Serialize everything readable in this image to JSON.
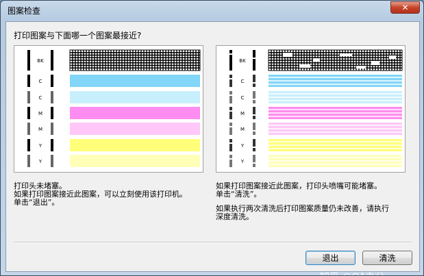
{
  "window": {
    "title": "图案检查",
    "close_glyph": "✕"
  },
  "dialog": {
    "question": "打印图案与下面哪一个图案最接近?",
    "left_panel": {
      "rows": [
        "BK",
        "C",
        "C",
        "M",
        "M",
        "Y",
        "Y"
      ],
      "caption_lines": [
        "打印头未堵塞。",
        "如果打印图案接近此图案，可以立刻使用该打印机。",
        "单击“退出”。"
      ]
    },
    "right_panel": {
      "rows": [
        "BK",
        "C",
        "C",
        "M",
        "M",
        "Y",
        "Y"
      ],
      "caption_lines": [
        "如果打印图案接近此图案，打印头喷嘴可能堵塞。",
        "单击“清洗”。"
      ],
      "caption2_lines": [
        "如果执行两次清洗后打印图案质量仍未改善，请执行",
        "深度清洗。"
      ]
    },
    "buttons": {
      "exit": "退出",
      "clean": "清洗"
    },
    "watermark": "知乎 @OA办公"
  },
  "colors": {
    "cyan": "#82d6f7",
    "light_cyan": "#c8effc",
    "magenta": "#ff8cf0",
    "light_magenta": "#ffc8f8",
    "yellow": "#ffff7a",
    "light_yellow": "#ffffb8"
  }
}
